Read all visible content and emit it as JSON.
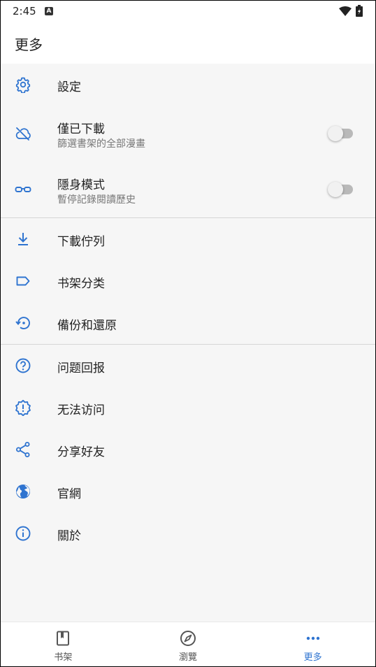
{
  "status": {
    "time": "2:45",
    "notif_letter": "A"
  },
  "header": {
    "title": "更多"
  },
  "colors": {
    "accent": "#2f74d0",
    "text": "#222222",
    "subtext": "#777777"
  },
  "items": {
    "settings": {
      "label": "設定",
      "icon": "gear-icon"
    },
    "downloaded_only": {
      "label": "僅已下載",
      "sub": "篩選書架的全部漫畫",
      "icon": "cloud-off-icon",
      "enabled": false
    },
    "incognito": {
      "label": "隱身模式",
      "sub": "暫停記錄閱讀歷史",
      "icon": "glasses-icon",
      "enabled": false
    },
    "download_queue": {
      "label": "下載佇列",
      "icon": "download-icon"
    },
    "categories": {
      "label": "书架分类",
      "icon": "label-icon"
    },
    "backup": {
      "label": "備份和還原",
      "icon": "restore-icon"
    },
    "feedback": {
      "label": "问题回报",
      "icon": "help-icon"
    },
    "cannot_access": {
      "label": "无法访问",
      "icon": "alert-badge-icon"
    },
    "share": {
      "label": "分享好友",
      "icon": "share-icon"
    },
    "website": {
      "label": "官網",
      "icon": "globe-icon"
    },
    "about": {
      "label": "關於",
      "icon": "info-icon"
    }
  },
  "bottom_nav": [
    {
      "label": "书架",
      "icon": "book-icon",
      "active": false
    },
    {
      "label": "瀏覽",
      "icon": "compass-icon",
      "active": false
    },
    {
      "label": "更多",
      "icon": "more-dots-icon",
      "active": true
    }
  ]
}
